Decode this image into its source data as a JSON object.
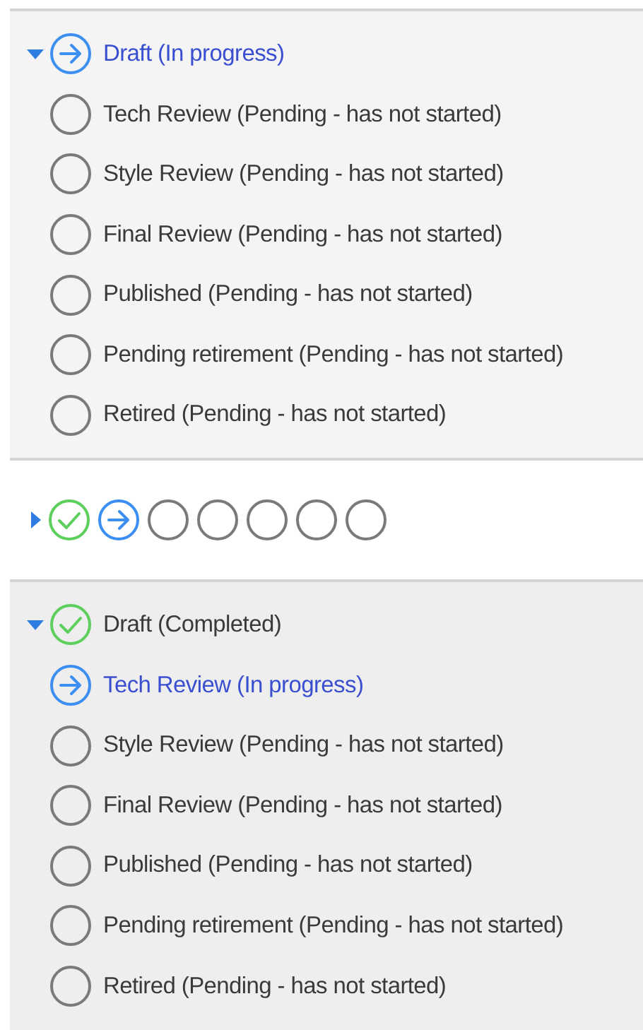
{
  "stages": [
    {
      "expanded": true,
      "steps": [
        {
          "kind": "in_progress",
          "label": "Draft (In progress)"
        },
        {
          "kind": "pending",
          "label": "Tech Review (Pending - has not started)"
        },
        {
          "kind": "pending",
          "label": "Style Review (Pending - has not started)"
        },
        {
          "kind": "pending",
          "label": "Final Review (Pending - has not started)"
        },
        {
          "kind": "pending",
          "label": "Published (Pending - has not started)"
        },
        {
          "kind": "pending",
          "label": "Pending retirement (Pending - has not started)"
        },
        {
          "kind": "pending",
          "label": "Retired (Pending - has not started)"
        }
      ]
    },
    {
      "expanded": false,
      "steps": [
        {
          "kind": "completed"
        },
        {
          "kind": "in_progress"
        },
        {
          "kind": "pending"
        },
        {
          "kind": "pending"
        },
        {
          "kind": "pending"
        },
        {
          "kind": "pending"
        },
        {
          "kind": "pending"
        }
      ]
    },
    {
      "expanded": true,
      "steps": [
        {
          "kind": "completed",
          "label": "Draft (Completed)"
        },
        {
          "kind": "in_progress",
          "label": "Tech Review (In progress)"
        },
        {
          "kind": "pending",
          "label": "Style Review (Pending - has not started)"
        },
        {
          "kind": "pending",
          "label": "Final Review (Pending - has not started)"
        },
        {
          "kind": "pending",
          "label": "Published (Pending - has not started)"
        },
        {
          "kind": "pending",
          "label": "Pending retirement (Pending - has not started)"
        },
        {
          "kind": "pending",
          "label": "Retired (Pending - has not started)"
        }
      ]
    }
  ]
}
